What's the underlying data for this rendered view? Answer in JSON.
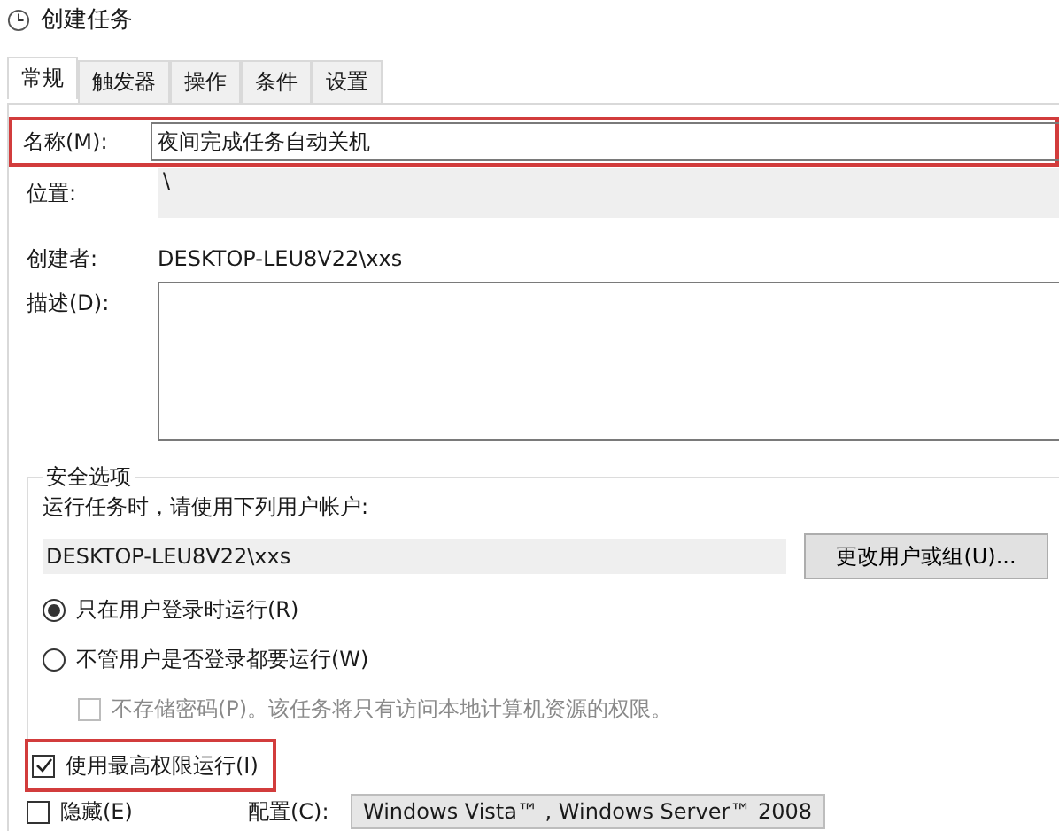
{
  "window": {
    "title": "创建任务"
  },
  "tabs": [
    {
      "label": "常规",
      "selected": true
    },
    {
      "label": "触发器",
      "selected": false
    },
    {
      "label": "操作",
      "selected": false
    },
    {
      "label": "条件",
      "selected": false
    },
    {
      "label": "设置",
      "selected": false
    }
  ],
  "general": {
    "name": {
      "label": "名称(M):",
      "value": "夜间完成任务自动关机",
      "highlighted": true
    },
    "location": {
      "label": "位置:",
      "value": "\\"
    },
    "author": {
      "label": "创建者:",
      "value": "DESKTOP-LEU8V22\\xxs"
    },
    "description": {
      "label": "描述(D):"
    }
  },
  "security": {
    "legend": "安全选项",
    "account_label": "运行任务时，请使用下列用户帐户:",
    "account": "DESKTOP-LEU8V22\\xxs",
    "change_button": "更改用户或组(U)...",
    "options": [
      {
        "kind": "radio",
        "label": "只在用户登录时运行(R)",
        "selected": true,
        "disabled": false,
        "highlighted": false
      },
      {
        "kind": "radio",
        "label": "不管用户是否登录都要运行(W)",
        "selected": false,
        "disabled": false,
        "highlighted": false
      },
      {
        "kind": "checkbox",
        "label": "不存储密码(P)。该任务将只有访问本地计算机资源的权限。",
        "checked": false,
        "disabled": true,
        "highlighted": false
      },
      {
        "kind": "checkbox",
        "label": "使用最高权限运行(I)",
        "checked": true,
        "disabled": false,
        "highlighted": true
      }
    ]
  },
  "footer": {
    "hidden": {
      "label": "隐藏(E)",
      "checked": false
    },
    "config_label": "配置(C):",
    "config_value": "Windows Vista™ , Windows Server™ 2008"
  }
}
